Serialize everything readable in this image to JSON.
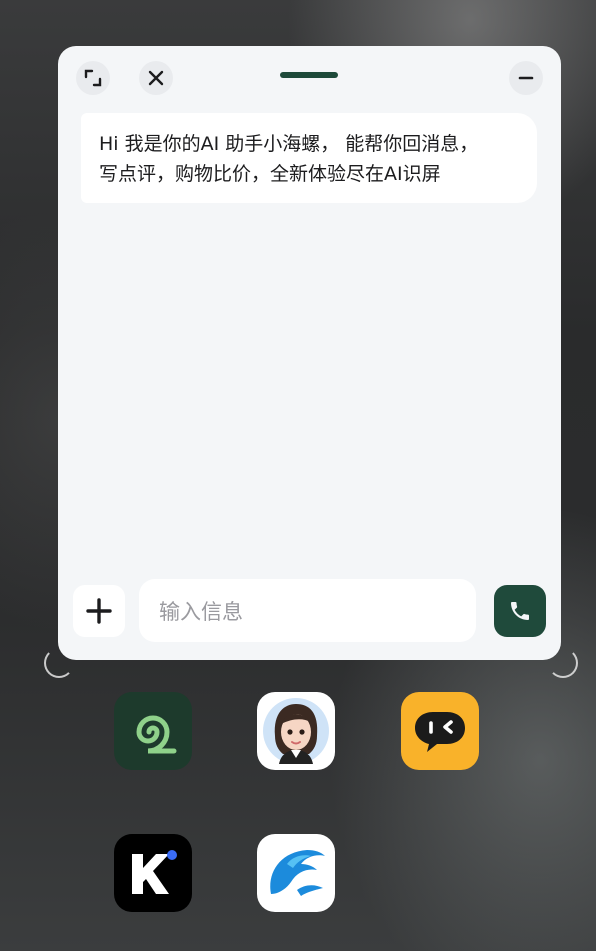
{
  "assistant_card": {
    "greeting": "Hi 我是你的AI 助手小海螺， 能帮你回消息，\n写点评，购物比价，全新体验尽在AI识屏",
    "input_placeholder": "输入信息",
    "input_value": "",
    "header_icons": [
      "expand-icon",
      "close-icon",
      "minimize-icon"
    ],
    "footer_icons": [
      "plus-icon",
      "phone-icon"
    ]
  },
  "dock_apps": [
    {
      "icon": "spiral-app-icon",
      "color": "#1d3a2c"
    },
    {
      "icon": "avatar-girl-app-icon",
      "color": "#ffffff"
    },
    {
      "icon": "chat-bubble-app-icon",
      "color": "#f9b22a"
    },
    {
      "icon": "k-letter-app-icon",
      "color": "#000000"
    },
    {
      "icon": "dolphin-app-icon",
      "color": "#ffffff"
    }
  ],
  "colors": {
    "accent_green": "#1f4a3b",
    "card_background": "#f4f6f8",
    "bubble_background": "#ffffff"
  }
}
